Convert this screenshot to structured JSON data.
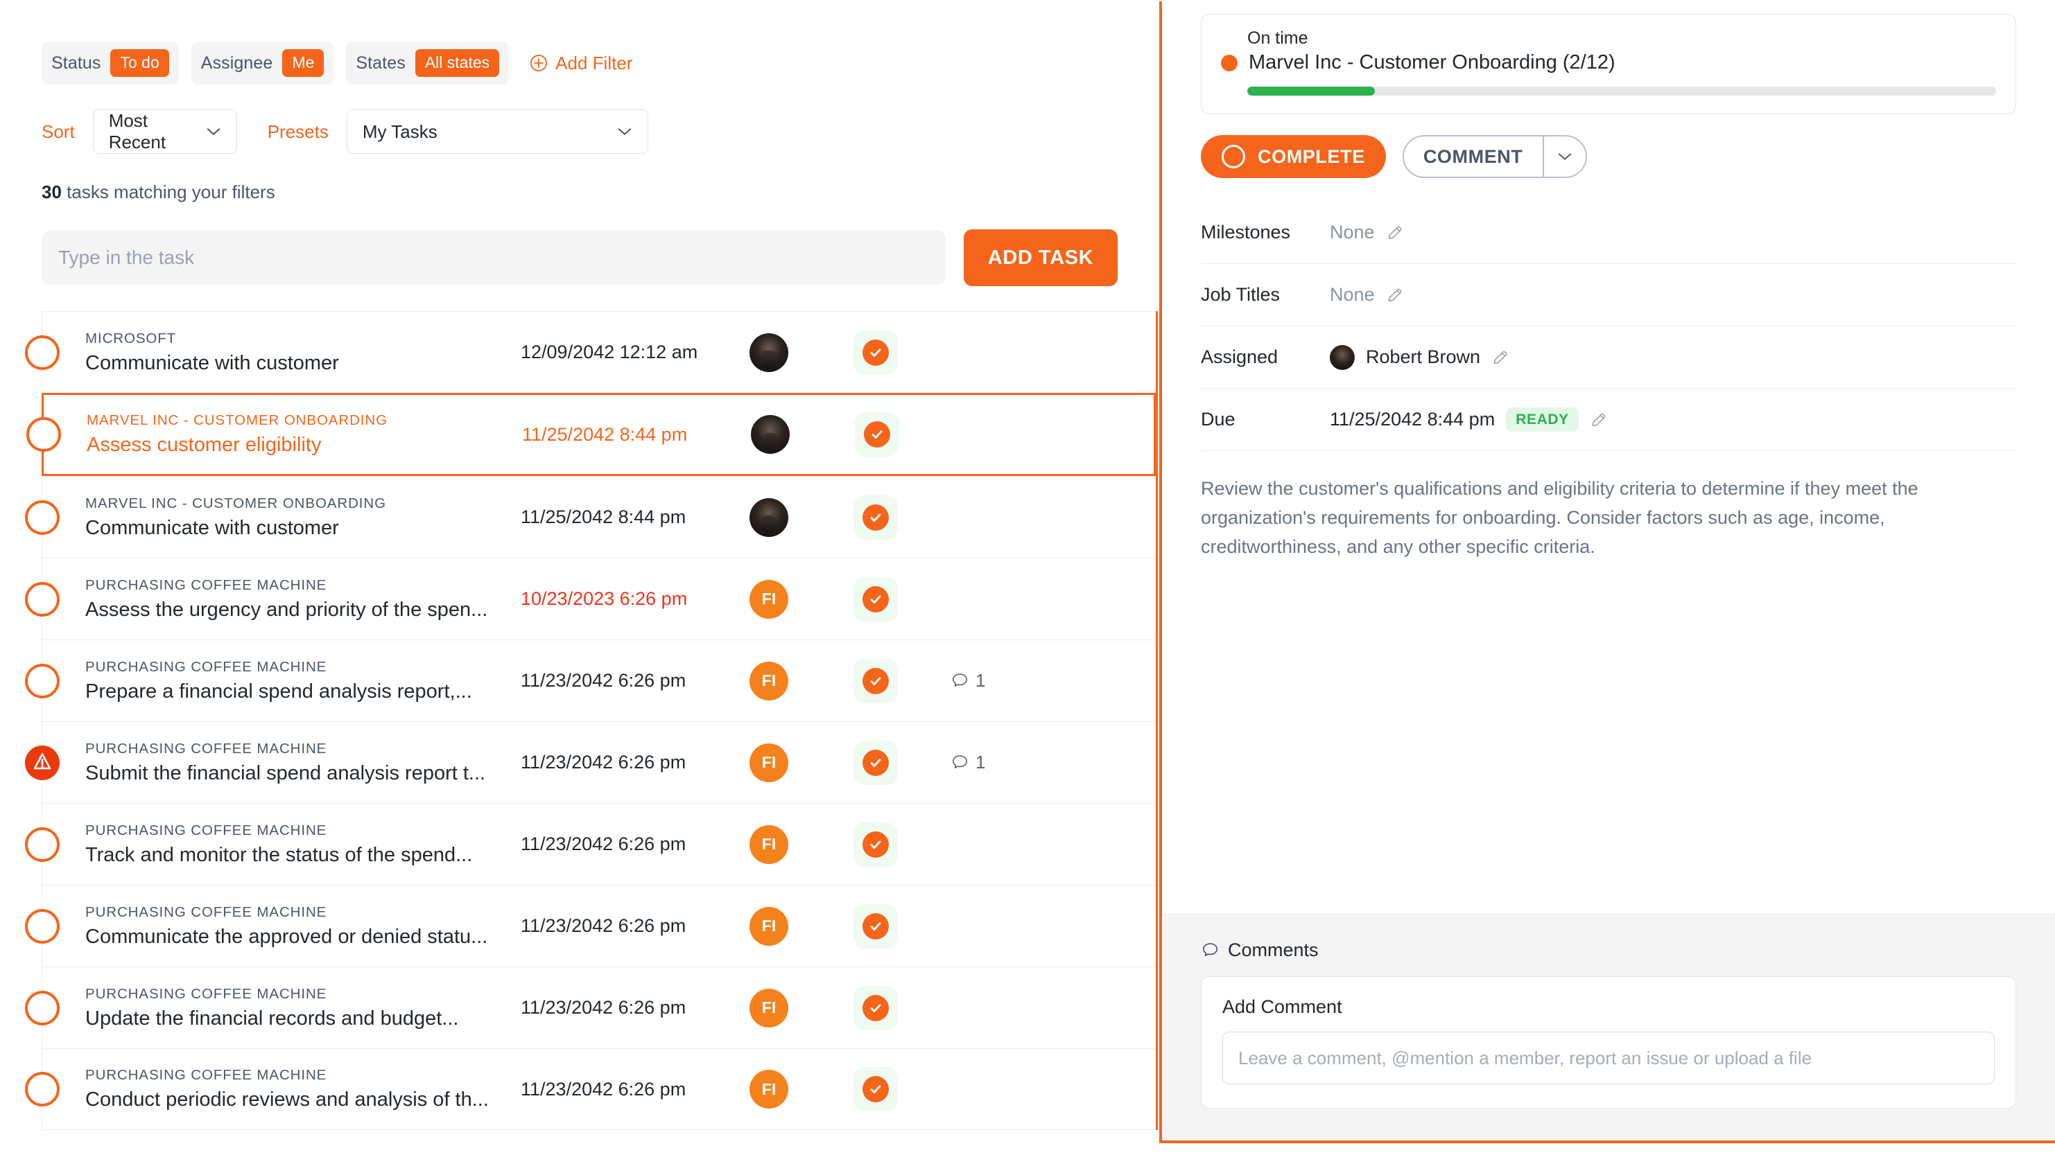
{
  "colors": {
    "accent": "#f4651b",
    "accent_text_overdue": "#f4321b",
    "green": "#2bb14e",
    "ready_badge_bg": "#e3f7e7",
    "complete_btn_bg": "#effaf1"
  },
  "filters": {
    "chips": [
      {
        "label": "Status",
        "value": "To do"
      },
      {
        "label": "Assignee",
        "value": "Me"
      },
      {
        "label": "States",
        "value": "All states"
      }
    ],
    "add_filter_label": "Add Filter",
    "add_filter_icon": "plus-circle-icon"
  },
  "controls": {
    "sort_label": "Sort",
    "sort_value": "Most Recent",
    "presets_label": "Presets",
    "presets_value": "My Tasks",
    "chevron_icon": "chevron-down-icon"
  },
  "summary": {
    "count": "30",
    "count_suffix": " tasks matching your filters"
  },
  "add_task": {
    "placeholder": "Type in the task",
    "value": "",
    "button_label": "ADD TASK"
  },
  "task_list": [
    {
      "project": "MICROSOFT",
      "title": "Communicate with customer",
      "date": "12/09/2042 12:12 am",
      "date_state": "normal",
      "avatar_type": "photo",
      "avatar_initials": "",
      "marker": "circle",
      "selected": false,
      "comments": ""
    },
    {
      "project": "MARVEL INC - CUSTOMER ONBOARDING",
      "title": "Assess customer eligibility",
      "date": "11/25/2042 8:44 pm",
      "date_state": "selected",
      "avatar_type": "photo",
      "avatar_initials": "",
      "marker": "circle",
      "selected": true,
      "comments": ""
    },
    {
      "project": "MARVEL INC - CUSTOMER ONBOARDING",
      "title": "Communicate with customer",
      "date": "11/25/2042 8:44 pm",
      "date_state": "normal",
      "avatar_type": "photo",
      "avatar_initials": "",
      "marker": "circle",
      "selected": false,
      "comments": ""
    },
    {
      "project": "PURCHASING COFFEE MACHINE",
      "title": "Assess the urgency and priority of the spen...",
      "date": "10/23/2023 6:26 pm",
      "date_state": "overdue",
      "avatar_type": "initials",
      "avatar_initials": "FI",
      "marker": "circle",
      "selected": false,
      "comments": ""
    },
    {
      "project": "PURCHASING COFFEE MACHINE",
      "title": "Prepare a financial spend analysis report,...",
      "date": "11/23/2042 6:26 pm",
      "date_state": "normal",
      "avatar_type": "initials",
      "avatar_initials": "FI",
      "marker": "circle",
      "selected": false,
      "comments": "1"
    },
    {
      "project": "PURCHASING COFFEE MACHINE",
      "title": "Submit the financial spend analysis report t...",
      "date": "11/23/2042 6:26 pm",
      "date_state": "normal",
      "avatar_type": "initials",
      "avatar_initials": "FI",
      "marker": "warning",
      "selected": false,
      "comments": "1"
    },
    {
      "project": "PURCHASING COFFEE MACHINE",
      "title": "Track and monitor the status of the spend...",
      "date": "11/23/2042 6:26 pm",
      "date_state": "normal",
      "avatar_type": "initials",
      "avatar_initials": "FI",
      "marker": "circle",
      "selected": false,
      "comments": ""
    },
    {
      "project": "PURCHASING COFFEE MACHINE",
      "title": "Communicate the approved or denied statu...",
      "date": "11/23/2042 6:26 pm",
      "date_state": "normal",
      "avatar_type": "initials",
      "avatar_initials": "FI",
      "marker": "circle",
      "selected": false,
      "comments": ""
    },
    {
      "project": "PURCHASING COFFEE MACHINE",
      "title": "Update the financial records and budget...",
      "date": "11/23/2042 6:26 pm",
      "date_state": "normal",
      "avatar_type": "initials",
      "avatar_initials": "FI",
      "marker": "circle",
      "selected": false,
      "comments": ""
    },
    {
      "project": "PURCHASING COFFEE MACHINE",
      "title": "Conduct periodic reviews and analysis of th...",
      "date": "11/23/2042 6:26 pm",
      "date_state": "normal",
      "avatar_type": "initials",
      "avatar_initials": "FI",
      "marker": "circle",
      "selected": false,
      "comments": ""
    }
  ],
  "detail": {
    "status_label": "On time",
    "status_title": "Marvel Inc - Customer Onboarding (2/12)",
    "progress_done": 2,
    "progress_total": 12,
    "progress_percent": 17,
    "complete_button": "COMPLETE",
    "comment_button": "COMMENT",
    "fields": [
      {
        "label": "Milestones",
        "value": "None",
        "type": "plain"
      },
      {
        "label": "Job Titles",
        "value": "None",
        "type": "plain"
      },
      {
        "label": "Assigned",
        "value": "Robert Brown",
        "type": "person"
      },
      {
        "label": "Due",
        "value": "11/25/2042 8:44 pm",
        "type": "date",
        "badge": "READY"
      }
    ],
    "description": "Review the customer's qualifications and eligibility criteria to determine if they meet the organization's requirements for onboarding. Consider factors such as age, income, creditworthiness, and any other specific criteria.",
    "comments": {
      "heading": "Comments",
      "heading_icon": "comment-bubble-icon",
      "add_label": "Add Comment",
      "placeholder": "Leave a comment, @mention a member, report an issue or upload a file",
      "value": ""
    }
  }
}
